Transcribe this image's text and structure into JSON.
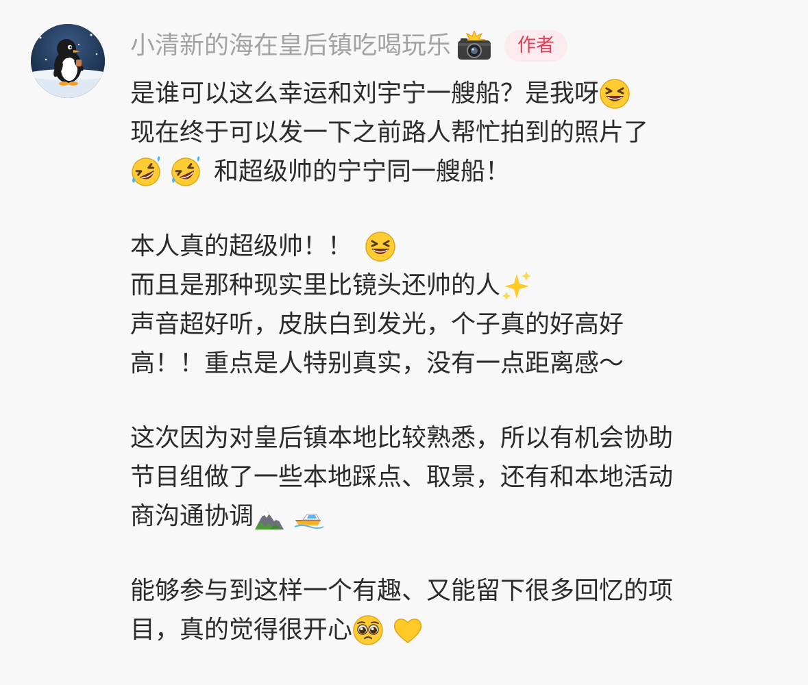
{
  "comment": {
    "username": "小清新的海在皇后镇吃喝玩乐",
    "username_emoji": "camera-flash-icon",
    "author_badge": "作者",
    "badge_color": "#e23b55",
    "badge_bg": "#fcebee",
    "paragraphs": [
      {
        "lines": [
          {
            "text": "是谁可以这么幸运和刘宇宁一艘船？是我呀",
            "emoji_after": [
              "grinning-squinting-face"
            ]
          },
          {
            "text": "现在终于可以发一下之前路人帮忙拍到的照片了",
            "emoji_after": []
          },
          {
            "emoji_before": [
              "rolling-on-floor-laughing",
              "rolling-on-floor-laughing"
            ],
            "text": "和超级帅的宁宁同一艘船！"
          }
        ]
      },
      {
        "lines": [
          {
            "text": "本人真的超级帅！！",
            "emoji_after": [
              "grinning-squinting-face"
            ]
          },
          {
            "text": "而且是那种现实里比镜头还帅的人",
            "emoji_after": [
              "sparkles"
            ]
          },
          {
            "text": "声音超好听，皮肤白到发光，个子真的好高好",
            "emoji_after": []
          },
          {
            "text": "高！！重点是人特别真实，没有一点距离感～",
            "emoji_after": []
          }
        ]
      },
      {
        "lines": [
          {
            "text": "这次因为对皇后镇本地比较熟悉，所以有机会协助",
            "emoji_after": []
          },
          {
            "text": "节目组做了一些本地踩点、取景，还有和本地活动",
            "emoji_after": []
          },
          {
            "text": "商沟通协调",
            "emoji_after": [
              "snow-capped-mountain",
              "speedboat"
            ]
          }
        ]
      },
      {
        "lines": [
          {
            "text": "能够参与到这样一个有趣、又能留下很多回忆的项",
            "emoji_after": []
          },
          {
            "text": "目，真的觉得很开心",
            "emoji_after": [
              "pleading-face",
              "yellow-heart"
            ]
          }
        ]
      }
    ]
  }
}
